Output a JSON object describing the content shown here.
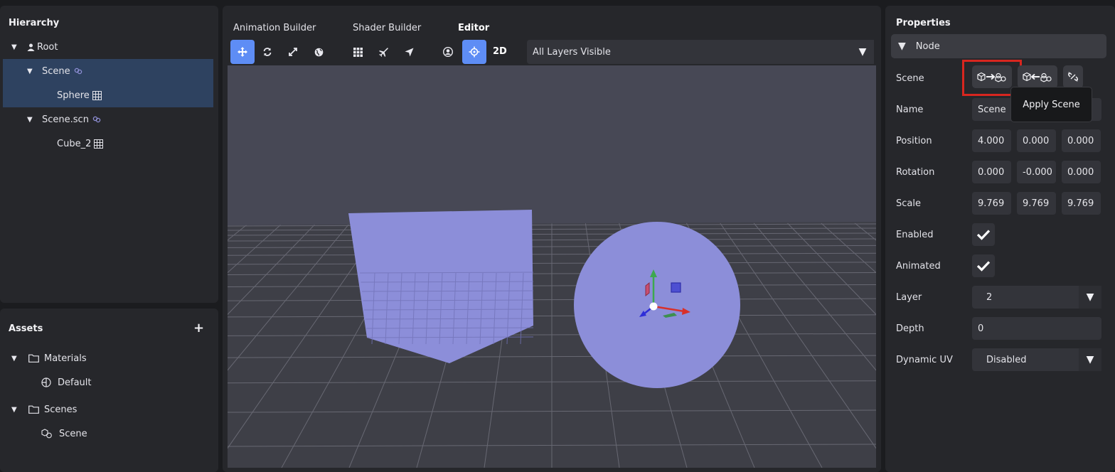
{
  "hierarchy": {
    "title": "Hierarchy",
    "items": [
      {
        "label": "Root"
      },
      {
        "label": "Scene"
      },
      {
        "label": "Sphere"
      },
      {
        "label": "Scene.scn"
      },
      {
        "label": "Cube_2"
      }
    ]
  },
  "assets": {
    "title": "Assets",
    "items": [
      {
        "label": "Materials"
      },
      {
        "label": "Default"
      },
      {
        "label": "Scenes"
      },
      {
        "label": "Scene"
      }
    ]
  },
  "editor": {
    "tabs": [
      "Animation Builder",
      "Shader Builder",
      "Editor"
    ],
    "mode_2d": "2D",
    "layers": "All Layers Visible"
  },
  "properties": {
    "title": "Properties",
    "section": "Node",
    "tooltip": "Apply Scene",
    "labels": {
      "scene": "Scene",
      "name": "Name",
      "position": "Position",
      "rotation": "Rotation",
      "scale": "Scale",
      "enabled": "Enabled",
      "animated": "Animated",
      "layer": "Layer",
      "depth": "Depth",
      "dynamic_uv": "Dynamic UV"
    },
    "name": "Scene",
    "position": [
      "4.000",
      "0.000",
      "0.000"
    ],
    "rotation": [
      "0.000",
      "-0.000",
      "0.000"
    ],
    "scale": [
      "9.769",
      "9.769",
      "9.769"
    ],
    "enabled": true,
    "animated": true,
    "layer": "2",
    "depth": "0",
    "dynamic_uv": "Disabled"
  },
  "colors": {
    "accent": "#5e8df5",
    "selection": "#2e4260",
    "object": "#8c8ed9",
    "highlight_box": "#d8261f"
  }
}
